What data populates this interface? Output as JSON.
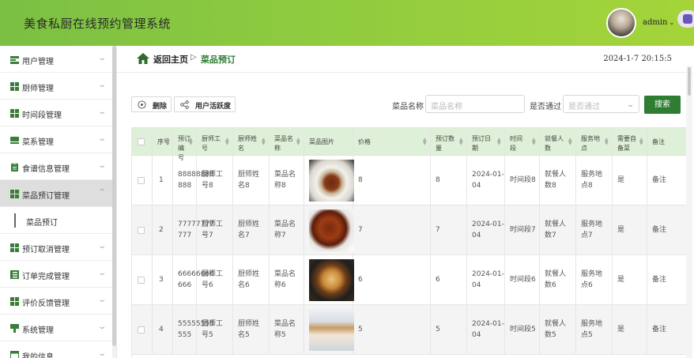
{
  "app": {
    "title": "美食私厨在线预约管理系统",
    "user": "admin"
  },
  "colors": {
    "brand_green": "#2e7d32",
    "header_green": "#8fcb3f",
    "table_header": "#dff0d8"
  },
  "sidebar": {
    "items": [
      {
        "label": "用户管理",
        "icon": "users-icon"
      },
      {
        "label": "厨师管理",
        "icon": "grid-icon"
      },
      {
        "label": "时间段管理",
        "icon": "grid-icon"
      },
      {
        "label": "菜系管理",
        "icon": "dish-icon"
      },
      {
        "label": "食谱信息管理",
        "icon": "clipboard-icon"
      },
      {
        "label": "菜品预订管理",
        "icon": "grid-icon"
      },
      {
        "label": "预订取消管理",
        "icon": "grid-icon"
      },
      {
        "label": "订单完成管理",
        "icon": "order-icon"
      },
      {
        "label": "评价反馈管理",
        "icon": "grid-icon"
      },
      {
        "label": "系统管理",
        "icon": "settings-icon"
      },
      {
        "label": "我的信息",
        "icon": "profile-icon"
      }
    ],
    "submenu": {
      "label": "菜品预订"
    }
  },
  "breadcrumb": {
    "home": "返回主页",
    "sep": "▷",
    "current": "菜品预订",
    "time": "2024-1-7 20:15:5"
  },
  "toolbar": {
    "delete": "删除",
    "activity": "用户活跃度"
  },
  "search": {
    "name_label": "菜品名称",
    "name_placeholder": "菜品名称",
    "pass_label": "是否通过",
    "pass_placeholder": "是否通过",
    "button": "搜索"
  },
  "table": {
    "headers": [
      [
        "序号"
      ],
      [
        "预订编",
        "号"
      ],
      [
        "厨师工",
        "号"
      ],
      [
        "厨师姓",
        "名"
      ],
      [
        "菜品名",
        "称"
      ],
      [
        "菜品图片"
      ],
      [
        "价格"
      ],
      [
        "预订数",
        "量"
      ],
      [
        "预订日",
        "期"
      ],
      [
        "时间",
        "段"
      ],
      [
        "就餐人",
        "数"
      ],
      [
        "服务地",
        "点"
      ],
      [
        "需要自",
        "备菜"
      ],
      [
        "备注"
      ]
    ],
    "rows": [
      {
        "idx": "1",
        "code": [
          "88888888",
          "888"
        ],
        "chef_no": [
          "厨师工",
          "号8"
        ],
        "chef_name": [
          "厨师姓",
          "名8"
        ],
        "dish": [
          "菜品名",
          "称8"
        ],
        "price": "8",
        "qty": "8",
        "date": [
          "2024-01-",
          "04"
        ],
        "slot": "时间段8",
        "diners": [
          "就餐人",
          "数8"
        ],
        "place": [
          "服务地",
          "点8"
        ],
        "self": "是",
        "note": "备注"
      },
      {
        "idx": "2",
        "code": [
          "77777777",
          "777"
        ],
        "chef_no": [
          "厨师工",
          "号7"
        ],
        "chef_name": [
          "厨师姓",
          "名7"
        ],
        "dish": [
          "菜品名",
          "称7"
        ],
        "price": "7",
        "qty": "7",
        "date": [
          "2024-01-",
          "04"
        ],
        "slot": "时间段7",
        "diners": [
          "就餐人",
          "数7"
        ],
        "place": [
          "服务地",
          "点7"
        ],
        "self": "是",
        "note": "备注"
      },
      {
        "idx": "3",
        "code": [
          "66666666",
          "666"
        ],
        "chef_no": [
          "厨师工",
          "号6"
        ],
        "chef_name": [
          "厨师姓",
          "名6"
        ],
        "dish": [
          "菜品名",
          "称6"
        ],
        "price": "6",
        "qty": "6",
        "date": [
          "2024-01-",
          "04"
        ],
        "slot": "时间段6",
        "diners": [
          "就餐人",
          "数6"
        ],
        "place": [
          "服务地",
          "点6"
        ],
        "self": "是",
        "note": "备注"
      },
      {
        "idx": "4",
        "code": [
          "55555555",
          "555"
        ],
        "chef_no": [
          "厨师工",
          "号5"
        ],
        "chef_name": [
          "厨师姓",
          "名5"
        ],
        "dish": [
          "菜品名",
          "称5"
        ],
        "price": "5",
        "qty": "5",
        "date": [
          "2024-01-",
          "04"
        ],
        "slot": "时间段5",
        "diners": [
          "就餐人",
          "数5"
        ],
        "place": [
          "服务地",
          "点5"
        ],
        "self": "是",
        "note": "备注"
      }
    ]
  }
}
